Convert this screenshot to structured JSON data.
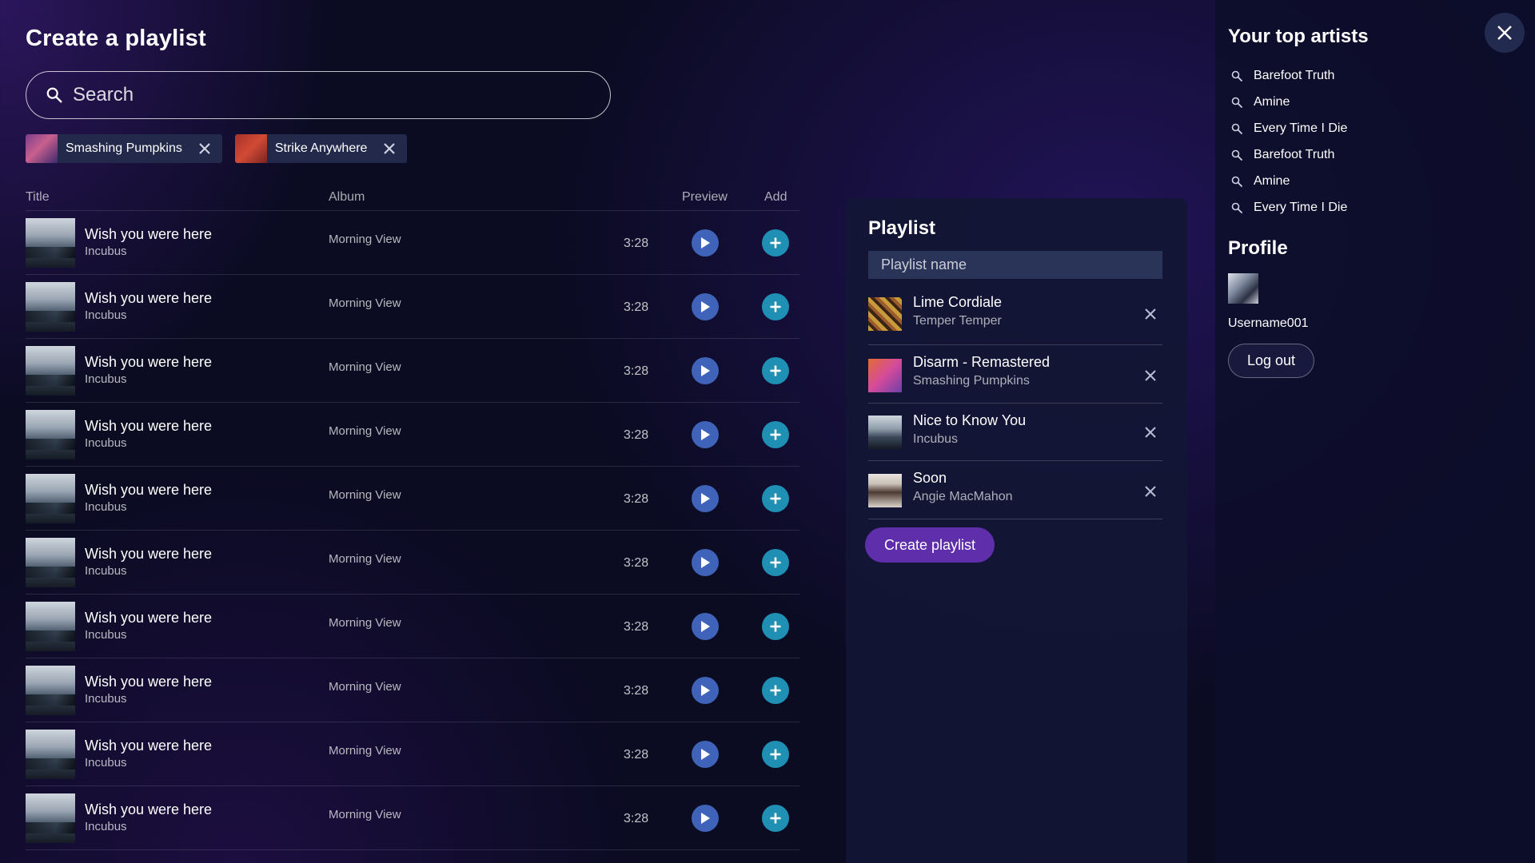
{
  "page": {
    "title": "Create a playlist"
  },
  "search": {
    "placeholder": "Search",
    "icon": "search-icon"
  },
  "chips": [
    {
      "label": "Smashing Pumpkins"
    },
    {
      "label": "Strike Anywhere"
    }
  ],
  "table": {
    "columns": {
      "title": "Title",
      "album": "Album",
      "preview": "Preview",
      "add": "Add"
    },
    "rows": [
      {
        "title": "Wish you were here",
        "artist": "Incubus",
        "album": "Morning View",
        "duration": "3:28"
      },
      {
        "title": "Wish you were here",
        "artist": "Incubus",
        "album": "Morning View",
        "duration": "3:28"
      },
      {
        "title": "Wish you were here",
        "artist": "Incubus",
        "album": "Morning View",
        "duration": "3:28"
      },
      {
        "title": "Wish you were here",
        "artist": "Incubus",
        "album": "Morning View",
        "duration": "3:28"
      },
      {
        "title": "Wish you were here",
        "artist": "Incubus",
        "album": "Morning View",
        "duration": "3:28"
      },
      {
        "title": "Wish you were here",
        "artist": "Incubus",
        "album": "Morning View",
        "duration": "3:28"
      },
      {
        "title": "Wish you were here",
        "artist": "Incubus",
        "album": "Morning View",
        "duration": "3:28"
      },
      {
        "title": "Wish you were here",
        "artist": "Incubus",
        "album": "Morning View",
        "duration": "3:28"
      },
      {
        "title": "Wish you were here",
        "artist": "Incubus",
        "album": "Morning View",
        "duration": "3:28"
      },
      {
        "title": "Wish you were here",
        "artist": "Incubus",
        "album": "Morning View",
        "duration": "3:28"
      }
    ]
  },
  "playlist": {
    "title": "Playlist",
    "name_placeholder": "Playlist name",
    "items": [
      {
        "song": "Lime Cordiale",
        "artist": "Temper Temper"
      },
      {
        "song": "Disarm - Remastered",
        "artist": "Smashing Pumpkins"
      },
      {
        "song": "Nice to Know You",
        "artist": "Incubus"
      },
      {
        "song": "Soon",
        "artist": "Angie MacMahon"
      }
    ],
    "create_label": "Create playlist"
  },
  "sidebar": {
    "top_artists_title": "Your top artists",
    "top_artists": [
      "Barefoot Truth",
      "Amine",
      "Every Time I Die",
      "Barefoot Truth",
      "Amine",
      "Every Time I Die"
    ],
    "profile_title": "Profile",
    "username": "Username001",
    "logout_label": "Log out"
  },
  "colors": {
    "background": "#0b0b22",
    "play_button": "#3e63b8",
    "add_button": "#1f8fb3",
    "create_button": "#5f2eaa",
    "chip": "#23294a",
    "panel": "#121634"
  },
  "icons": {
    "close": "close-icon",
    "play": "play-icon",
    "add": "plus-icon",
    "remove": "x-icon"
  }
}
